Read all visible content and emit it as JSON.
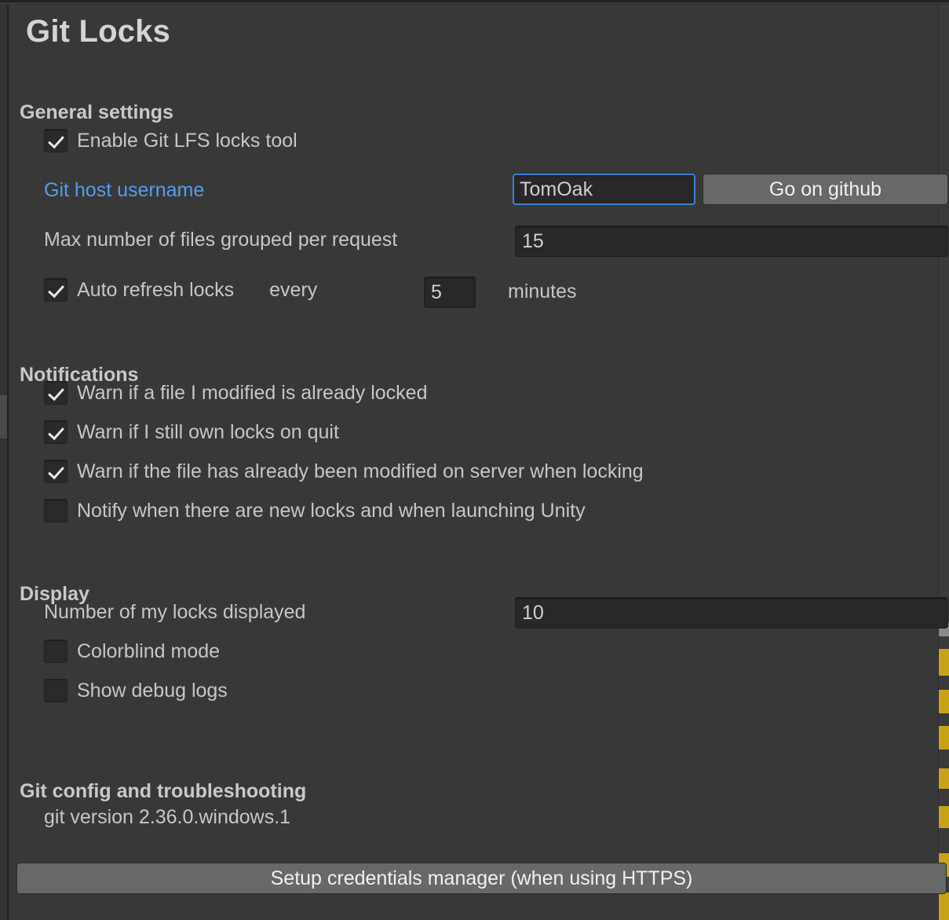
{
  "window": {
    "title": "Git Locks"
  },
  "sections": {
    "general": {
      "heading": "General settings",
      "enable_tool": {
        "label": "Enable Git LFS locks tool",
        "checked": true
      },
      "username": {
        "label": "Git host username",
        "value": "TomOak",
        "placeholder": "",
        "button_label": "Go on github"
      },
      "max_files": {
        "label": "Max number of files grouped per request",
        "value": "15",
        "placeholder": ""
      },
      "auto_refresh": {
        "label": "Auto refresh locks",
        "checked": true,
        "every_label": "every",
        "value": "5",
        "unit_label": "minutes"
      }
    },
    "notifications": {
      "heading": "Notifications",
      "items": [
        {
          "label": "Warn if a file I modified is already locked",
          "checked": true
        },
        {
          "label": "Warn if I still own locks on quit",
          "checked": true
        },
        {
          "label": "Warn if the file has already been modified on server when locking",
          "checked": true
        },
        {
          "label": "Notify when there are new locks and when launching Unity",
          "checked": false
        }
      ]
    },
    "display": {
      "heading": "Display",
      "locks_displayed": {
        "label": "Number of my locks displayed",
        "value": "10",
        "placeholder": ""
      },
      "items": [
        {
          "label": "Colorblind mode",
          "checked": false
        },
        {
          "label": "Show debug logs",
          "checked": false
        }
      ]
    },
    "git_config": {
      "heading": "Git config and troubleshooting",
      "version_text": "git version 2.36.0.windows.1",
      "setup_button_label": "Setup credentials manager (when using HTTPS)"
    }
  },
  "colors": {
    "background": "#383838",
    "text": "#c6c6c6",
    "heading": "#c9c9c9",
    "link": "#5a9ae8",
    "focus_border": "#3d7fd6",
    "input_background": "#282828",
    "button_background": "#686868",
    "accent_amber": "#c8a317"
  }
}
